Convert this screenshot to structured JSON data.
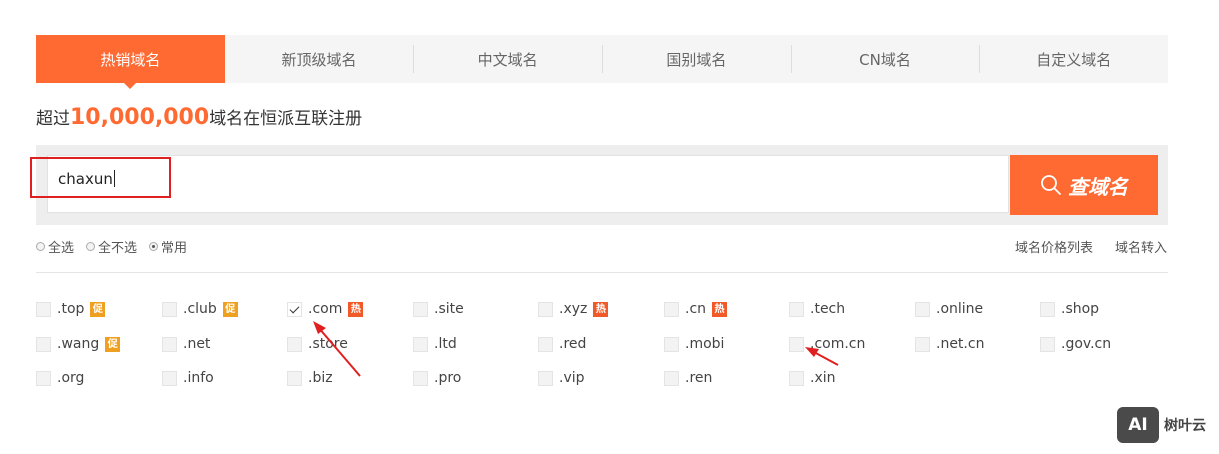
{
  "tabs": [
    {
      "label": "热销域名",
      "active": true
    },
    {
      "label": "新顶级域名",
      "active": false
    },
    {
      "label": "中文域名",
      "active": false
    },
    {
      "label": "国别域名",
      "active": false
    },
    {
      "label": "CN域名",
      "active": false
    },
    {
      "label": "自定义域名",
      "active": false
    }
  ],
  "tagline": {
    "prefix": "超过",
    "count": "10,000,000",
    "suffix": "域名在恒派互联注册"
  },
  "search": {
    "value": "chaxun",
    "button_label": "查域名"
  },
  "options": [
    {
      "label": "全选",
      "selected": false
    },
    {
      "label": "全不选",
      "selected": false
    },
    {
      "label": "常用",
      "selected": true
    }
  ],
  "links": {
    "price_list": "域名价格列表",
    "transfer": "域名转入"
  },
  "suffixes": [
    {
      "name": ".top",
      "badge": "促",
      "checked": false
    },
    {
      "name": ".club",
      "badge": "促",
      "checked": false
    },
    {
      "name": ".com",
      "badge": "热",
      "checked": true
    },
    {
      "name": ".site",
      "badge": "",
      "checked": false
    },
    {
      "name": ".xyz",
      "badge": "热",
      "checked": false
    },
    {
      "name": ".cn",
      "badge": "热",
      "checked": false
    },
    {
      "name": ".tech",
      "badge": "",
      "checked": false
    },
    {
      "name": ".online",
      "badge": "",
      "checked": false
    },
    {
      "name": ".shop",
      "badge": "",
      "checked": false
    },
    {
      "name": ".wang",
      "badge": "促",
      "checked": false
    },
    {
      "name": ".net",
      "badge": "",
      "checked": false
    },
    {
      "name": ".store",
      "badge": "",
      "checked": false
    },
    {
      "name": ".ltd",
      "badge": "",
      "checked": false
    },
    {
      "name": ".red",
      "badge": "",
      "checked": false
    },
    {
      "name": ".mobi",
      "badge": "",
      "checked": false
    },
    {
      "name": ".com.cn",
      "badge": "",
      "checked": false
    },
    {
      "name": ".net.cn",
      "badge": "",
      "checked": false
    },
    {
      "name": ".gov.cn",
      "badge": "",
      "checked": false
    },
    {
      "name": ".org",
      "badge": "",
      "checked": false
    },
    {
      "name": ".info",
      "badge": "",
      "checked": false
    },
    {
      "name": ".biz",
      "badge": "",
      "checked": false
    },
    {
      "name": ".pro",
      "badge": "",
      "checked": false
    },
    {
      "name": ".vip",
      "badge": "",
      "checked": false
    },
    {
      "name": ".ren",
      "badge": "",
      "checked": false
    },
    {
      "name": ".xin",
      "badge": "",
      "checked": false
    }
  ],
  "badge_colors": {
    "促": "#f0a020",
    "热": "#f05a28"
  },
  "colors": {
    "accent": "#ff6a33",
    "annotation": "#e02020"
  },
  "watermark": {
    "logo": "AI",
    "text": "树叶云"
  }
}
